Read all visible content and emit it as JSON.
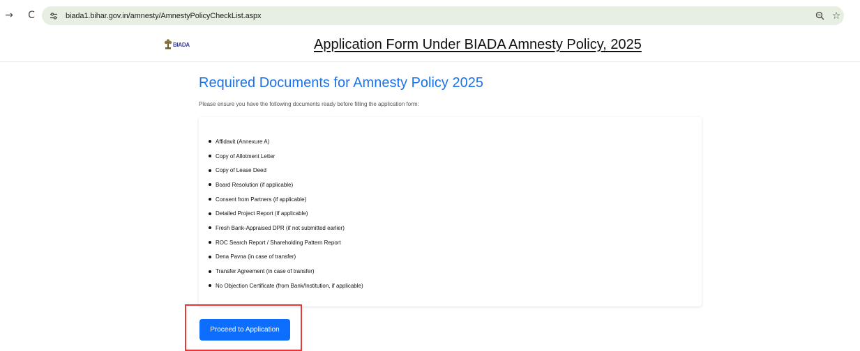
{
  "browser": {
    "forward_icon": "→",
    "reload_icon": "C",
    "url": "biada1.bihar.gov.in/amnesty/AmnestyPolicyCheckList.aspx",
    "zoom_icon": "⚲",
    "star_icon": "☆"
  },
  "header": {
    "logo_text": "BIADA",
    "title": "Application Form Under BIADA Amnesty Policy, 2025"
  },
  "main": {
    "heading": "Required Documents for Amnesty Policy 2025",
    "intro": "Please ensure you have the following documents ready before filling the application form:",
    "documents": [
      "Affidavit (Annexure A)",
      "Copy of Allotment Letter",
      "Copy of Lease Deed",
      "Board Resolution (if applicable)",
      "Consent from Partners (if applicable)",
      "Detailed Project Report (if applicable)",
      "Fresh Bank-Appraised DPR (if not submitted earlier)",
      "ROC Search Report / Shareholding Pattern Report",
      "Dena Pavna (in case of transfer)",
      "Transfer Agreement (in case of transfer)",
      "No Objection Certificate (from Bank/Institution, if applicable)"
    ],
    "proceed_label": "Proceed to Application"
  },
  "colors": {
    "heading": "#1a73e8",
    "button": "#0d6efd",
    "highlight": "#e53935",
    "omnibox": "#e7efe2"
  }
}
